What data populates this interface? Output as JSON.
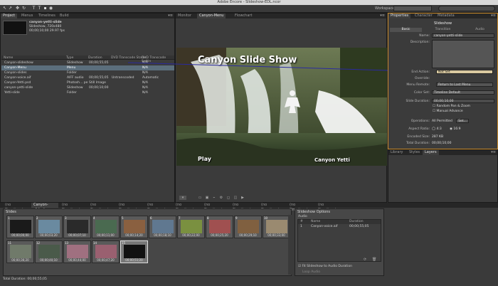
{
  "window_title": "Adobe Encore - Slideshow-EDL.ncor",
  "toolbar": {
    "workspace_label": "Workspace:",
    "workspace_value": ""
  },
  "project": {
    "tabs": [
      "Project",
      "Menus",
      "Timelines",
      "Build"
    ],
    "item_name": "canyon-yetti-slide",
    "item_lines": [
      "Slideshow, 720x480",
      "00;00;10;00 29.97 fps"
    ],
    "columns": [
      "Name",
      "Type",
      "Duration",
      "DVD Transcode Status",
      "DVD Transcode Settin"
    ],
    "rows": [
      {
        "name": "Canyon-slideshow",
        "type": "Slideshow",
        "duration": "00;00;55;05",
        "status": "",
        "settings": "N/A",
        "selected": false
      },
      {
        "name": "Canyon-Menu",
        "type": "Menu",
        "duration": "",
        "status": "",
        "settings": "N/A",
        "selected": true
      },
      {
        "name": "Canyon-slides",
        "type": "Folder",
        "duration": "",
        "status": "",
        "settings": "N/A",
        "selected": false
      },
      {
        "name": "Canyon-voice.aif",
        "type": "AIFF audio",
        "duration": "00;00;55;05",
        "status": "Untranscoded",
        "settings": "Automatic",
        "selected": false
      },
      {
        "name": "Canyon-Yetti.psd",
        "type": "Photosh... pe",
        "duration": "Still Image",
        "status": "",
        "settings": "N/A",
        "selected": false
      },
      {
        "name": "canyon-yetti-slide",
        "type": "Slideshow",
        "duration": "00;00;10;00",
        "status": "",
        "settings": "N/A",
        "selected": false
      },
      {
        "name": "Yetti-slide",
        "type": "Folder",
        "duration": "",
        "status": "",
        "settings": "N/A",
        "selected": false
      }
    ]
  },
  "monitor": {
    "tabs": [
      "Monitor",
      "Canyon-Menu",
      "Flowchart"
    ],
    "menu_title": "Canyon Slide Show",
    "button_play": "Play",
    "button_yetti": "Canyon Yetti"
  },
  "properties": {
    "tabs": [
      "Properties",
      "Character",
      "Metadata"
    ],
    "heading": "Slideshow",
    "subtabs": [
      "Basic",
      "Transition",
      "Audio"
    ],
    "name_label": "Name:",
    "name_value": "canyon-yetti-slide",
    "description_label": "Description:",
    "end_action_label": "End Action:",
    "end_action_value": "Not Set",
    "override_label": "Override:",
    "menu_remote_label": "Menu Remote:",
    "menu_remote_value": "Return to Last Menu",
    "color_set_label": "Color Set:",
    "color_set_value": "Timeline Default",
    "slide_duration_label": "Slide Duration:",
    "slide_duration_value": "00;00;10;00",
    "random_pan": "Random Pan & Zoom",
    "manual_advance": "Manual Advance",
    "operations_label": "Operations:",
    "operations_value": "All Permitted",
    "set_button": "Set...",
    "aspect_label": "Aspect Ratio:",
    "aspect_43": "4:3",
    "aspect_169": "16:9",
    "encoded_label": "Encoded Size:",
    "encoded_value": "287 KB",
    "total_label": "Total Duration:",
    "total_value": "00;00;10;00"
  },
  "layers": {
    "tabs": [
      "Library",
      "Styles",
      "Layers"
    ]
  },
  "timeline": {
    "tabs": [
      "(no Timelines)",
      "Canyon-slideshow",
      "(no Timelines)",
      "(no Timelines)",
      "(no Timelines)",
      "(no Timelines)",
      "(no Timelines)",
      "(no Timelines)",
      "(no Timelines)",
      "(no Timelines)",
      "(no Timelines)",
      "(no Timelines)"
    ],
    "slides_label": "Slides",
    "options_label": "Slideshow Options",
    "audio_label": "Audio",
    "audio_columns": [
      "#",
      "Name",
      "Duration"
    ],
    "audio_rows": [
      {
        "num": "1",
        "name": "Canyon-voice.aif",
        "duration": "00;00;55;05"
      }
    ],
    "fit_label": "Fit Slideshow to Audio Duration",
    "loop_label": "Loop Audio",
    "total_duration": "Total Duration: 00;00;55;05"
  },
  "slides": [
    {
      "num": "1",
      "tc": "00;00;00;00",
      "color": "#1a1a1a"
    },
    {
      "num": "2",
      "tc": "00;00;03;20",
      "color": "#6a8aa0"
    },
    {
      "num": "3",
      "tc": "00;00;07;10",
      "color": "#2a2a2a"
    },
    {
      "num": "4",
      "tc": "00;00;11;00",
      "color": "#4a6a50"
    },
    {
      "num": "5",
      "tc": "00;00;14;20",
      "color": "#8a6040"
    },
    {
      "num": "6",
      "tc": "00;00;18;10",
      "color": "#607890"
    },
    {
      "num": "7",
      "tc": "00;00;22;00",
      "color": "#7a9040"
    },
    {
      "num": "8",
      "tc": "00;00;25;20",
      "color": "#a05050"
    },
    {
      "num": "9",
      "tc": "00;00;29;10",
      "color": "#806040"
    },
    {
      "num": "10",
      "tc": "00;00;33;00",
      "color": "#9a8a70"
    },
    {
      "num": "11",
      "tc": "00;00;36;20",
      "color": "#707a6a"
    },
    {
      "num": "12",
      "tc": "00;00;40;10",
      "color": "#4a5a4a"
    },
    {
      "num": "13",
      "tc": "00;00;44;00",
      "color": "#a07080"
    },
    {
      "num": "14",
      "tc": "00;00;47;20",
      "color": "#9a6070"
    },
    {
      "num": "15",
      "tc": "00;00;51;20",
      "color": "#111111"
    }
  ]
}
